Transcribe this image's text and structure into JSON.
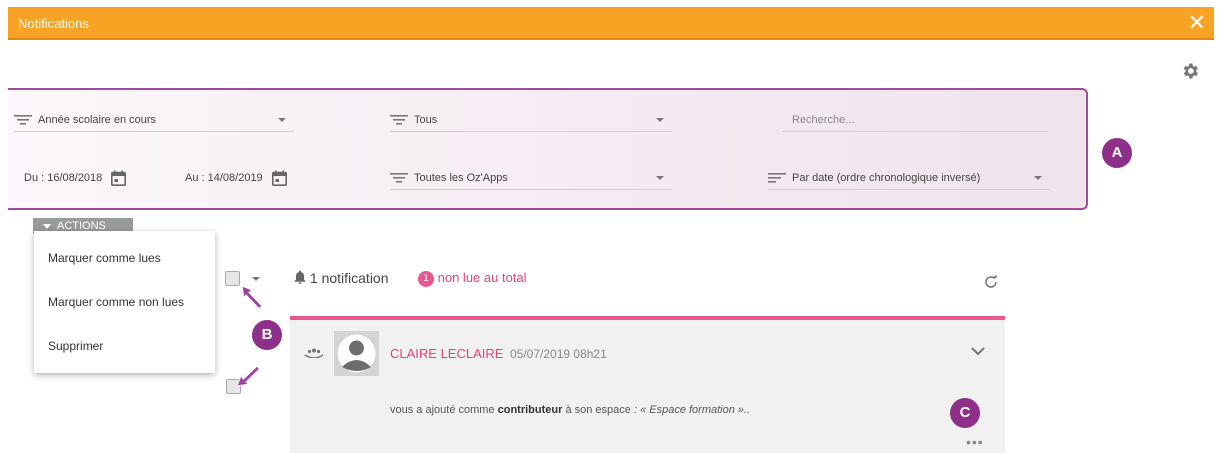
{
  "window": {
    "title": "Notifications",
    "close_glyph": "✕"
  },
  "filters": {
    "year": "Année scolaire en cours",
    "type": "Tous",
    "search_placeholder": "Recherche...",
    "date_from": "Du : 16/08/2018",
    "date_to": "Au : 14/08/2019",
    "apps": "Toutes les Oz'Apps",
    "sort": "Par date (ordre chronologique inversé)"
  },
  "annotations": {
    "a": "A",
    "b": "B",
    "c": "C"
  },
  "actions": {
    "button_label": "ACTIONS",
    "menu": [
      "Marquer comme lues",
      "Marquer comme non lues",
      "Supprimer"
    ]
  },
  "summary": {
    "count_text": "1 notification",
    "unread_count": "1",
    "unread_text": "non lue au total"
  },
  "notification": {
    "author": "CLAIRE LECLAIRE",
    "datetime": "05/07/2019 08h21",
    "msg_prefix": "vous a ajouté comme ",
    "msg_bold": "contributeur",
    "msg_middle": " à son espace ",
    "msg_italic": ": « Espace formation »..",
    "more_glyph": "•••"
  },
  "colors": {
    "titlebar": "#f8a325",
    "annotation": "#8e2f89",
    "accent_pink": "#e2447c",
    "card_border": "#e8588c"
  },
  "icons": [
    "close-icon",
    "gear-icon",
    "filter-icon",
    "sort-icon",
    "calendar-icon",
    "bell-icon",
    "refresh-icon",
    "group-icon",
    "chevron-down-icon",
    "more-icon",
    "pointer-arrow-icon"
  ]
}
